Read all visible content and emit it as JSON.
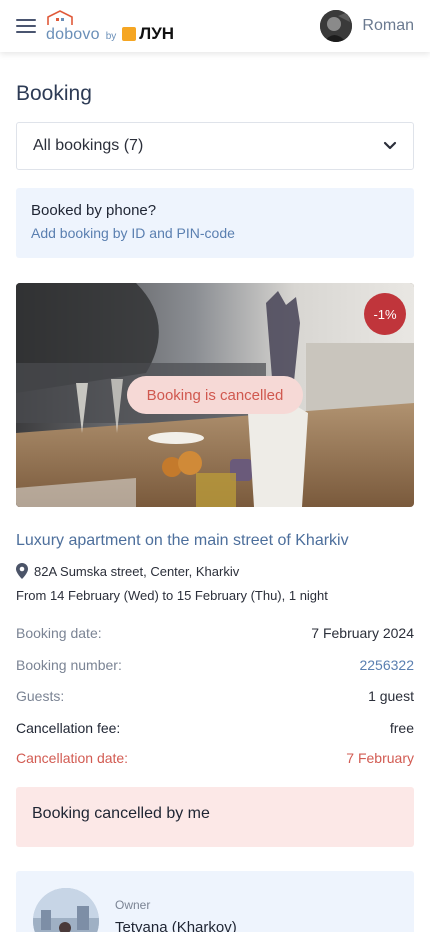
{
  "header": {
    "logo_text": "dobovo",
    "logo_by": "by",
    "logo_partner": "ЛУН",
    "user_name": "Roman"
  },
  "page": {
    "title": "Booking"
  },
  "filter": {
    "selected": "All bookings (7)"
  },
  "phone_booking": {
    "question": "Booked by phone?",
    "link": "Add booking by ID and PIN-code"
  },
  "booking": {
    "discount_badge": "-1%",
    "status": "Booking is cancelled",
    "title": "Luxury apartment on the main street of Kharkiv",
    "address": "82A Sumska street, Center, Kharkiv",
    "dates": "From 14 February (Wed) to 15 February (Thu), 1 night",
    "details": {
      "booking_date_label": "Booking date:",
      "booking_date_value": "7 February 2024",
      "booking_number_label": "Booking number:",
      "booking_number_value": "2256322",
      "guests_label": "Guests:",
      "guests_value": "1 guest",
      "cancellation_fee_label": "Cancellation fee:",
      "cancellation_fee_value": "free",
      "cancellation_date_label": "Cancellation date:",
      "cancellation_date_value": "7 February"
    },
    "cancelled_by": "Booking cancelled by me"
  },
  "owner": {
    "role": "Owner",
    "name": "Tetyana (Kharkov)"
  },
  "colors": {
    "accent_blue": "#5a7fb0",
    "badge_red": "#c0353b",
    "cancel_text": "#d25b52",
    "info_bg": "#eef4fd",
    "cancel_bg": "#fce8e7"
  },
  "icons": {
    "menu": "hamburger-menu-icon",
    "house": "house-logo-icon",
    "chevron": "chevron-down-icon",
    "pin": "map-pin-icon"
  }
}
